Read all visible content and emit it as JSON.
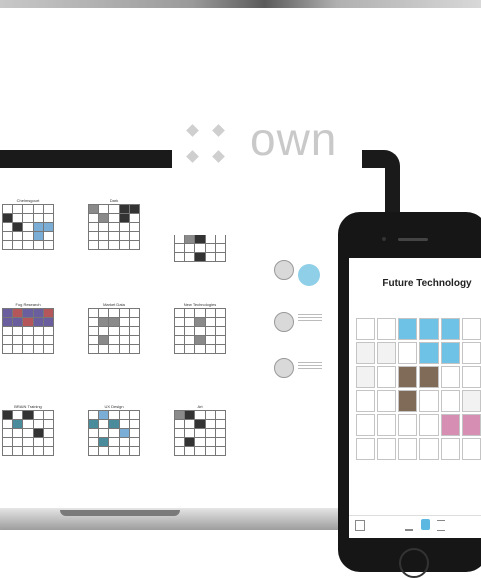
{
  "logo": {
    "text": "own"
  },
  "laptop": {
    "boards": [
      {
        "label": "Chelmsgourt"
      },
      {
        "label": "Dark"
      },
      {
        "label": ""
      },
      {
        "label": "Fog Research"
      },
      {
        "label": "Market Data"
      },
      {
        "label": "New Technologies"
      },
      {
        "label": "BRAIN Training"
      },
      {
        "label": "UX Design"
      },
      {
        "label": "Art"
      }
    ]
  },
  "phone": {
    "title": "Future Technology"
  }
}
